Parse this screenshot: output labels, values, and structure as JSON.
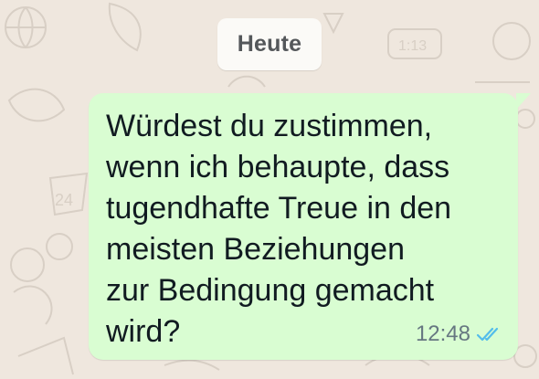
{
  "date_chip": {
    "label": "Heute"
  },
  "message": {
    "direction": "outgoing",
    "text": "Würdest du zustimmen,\nwenn ich behaupte, dass\ntugendhafte Treue in den\nmeisten Beziehungen\nzur Bedingung gemacht\nwird?",
    "time": "12:48",
    "status_icon": "double-check-read-icon"
  },
  "wallpaper": {
    "label_24": "24",
    "label_113": "1:13"
  },
  "colors": {
    "background": "#efe7de",
    "bubble_outgoing": "#d9fdd2",
    "date_chip": "#fbfaf7",
    "read_ticks": "#53bdeb",
    "timestamp": "#667781",
    "text": "#111b21"
  }
}
